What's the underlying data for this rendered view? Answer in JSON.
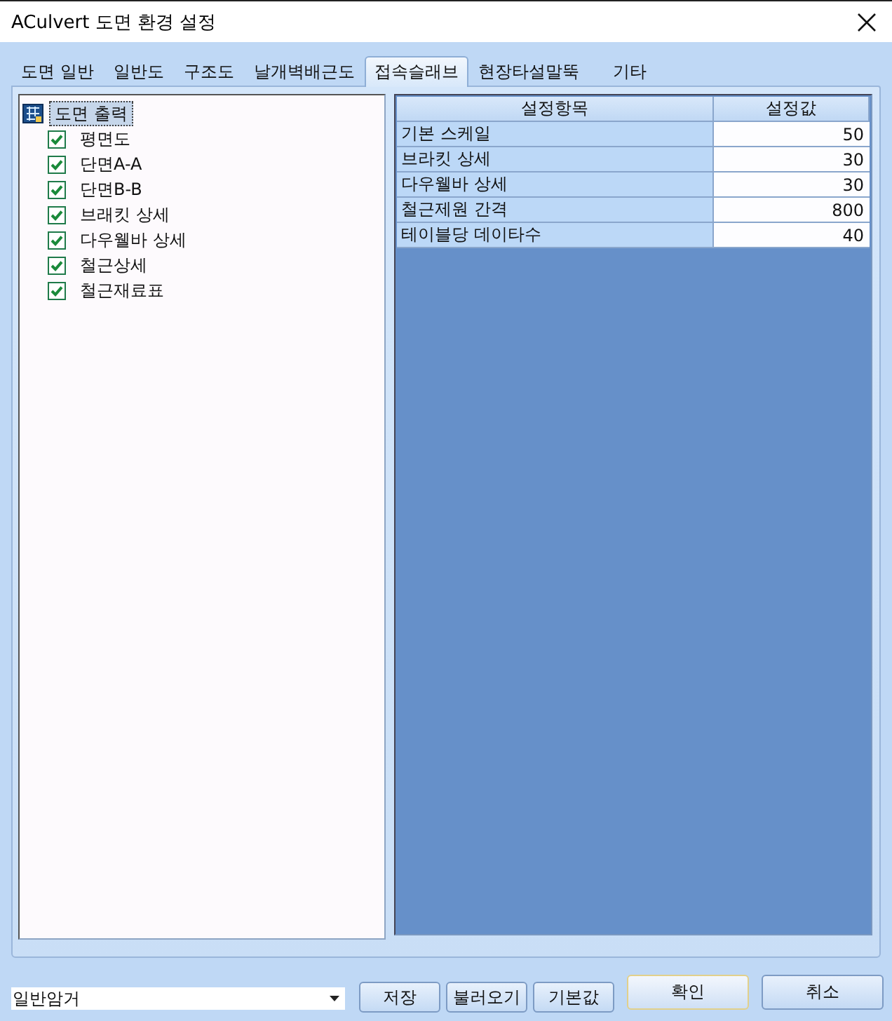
{
  "window": {
    "title": "ACulvert 도면 환경 설정"
  },
  "tabs": [
    {
      "label": "도면 일반",
      "selected": false
    },
    {
      "label": "일반도",
      "selected": false
    },
    {
      "label": "구조도",
      "selected": false
    },
    {
      "label": "날개벽배근도",
      "selected": false
    },
    {
      "label": "접속슬래브",
      "selected": true
    },
    {
      "label": "현장타설말뚝",
      "selected": false
    },
    {
      "label": "기타",
      "selected": false
    }
  ],
  "tree": [
    {
      "label": "도면 출력",
      "selected": true,
      "children": [
        {
          "label": "평면도",
          "checked": true,
          "selected": false
        },
        {
          "label": "단면A-A",
          "checked": true,
          "selected": false
        },
        {
          "label": "단면B-B",
          "checked": true,
          "selected": false
        },
        {
          "label": "브래킷 상세",
          "checked": true,
          "selected": false
        },
        {
          "label": "다우웰바 상세",
          "checked": true,
          "selected": false
        },
        {
          "label": "철근상세",
          "checked": true,
          "selected": false
        },
        {
          "label": "철근재료표",
          "checked": true,
          "selected": false
        }
      ]
    }
  ],
  "grid": {
    "columns": [
      "설정항목",
      "설정값"
    ],
    "rows": [
      {
        "item": "기본 스케일",
        "value": "50"
      },
      {
        "item": "브라킷 상세",
        "value": "30"
      },
      {
        "item": "다우웰바 상세",
        "value": "30"
      },
      {
        "item": "철근제원 간격",
        "value": "800"
      },
      {
        "item": "테이블당 데이타수",
        "value": "40"
      }
    ]
  },
  "footer": {
    "preset": {
      "value": "일반암거"
    },
    "buttons": [
      {
        "label": "저장",
        "kind": "small"
      },
      {
        "label": "불러오기",
        "kind": "small"
      },
      {
        "label": "기본값",
        "kind": "small"
      },
      {
        "label": "확인",
        "kind": "default"
      },
      {
        "label": "취소",
        "kind": "large"
      }
    ]
  }
}
